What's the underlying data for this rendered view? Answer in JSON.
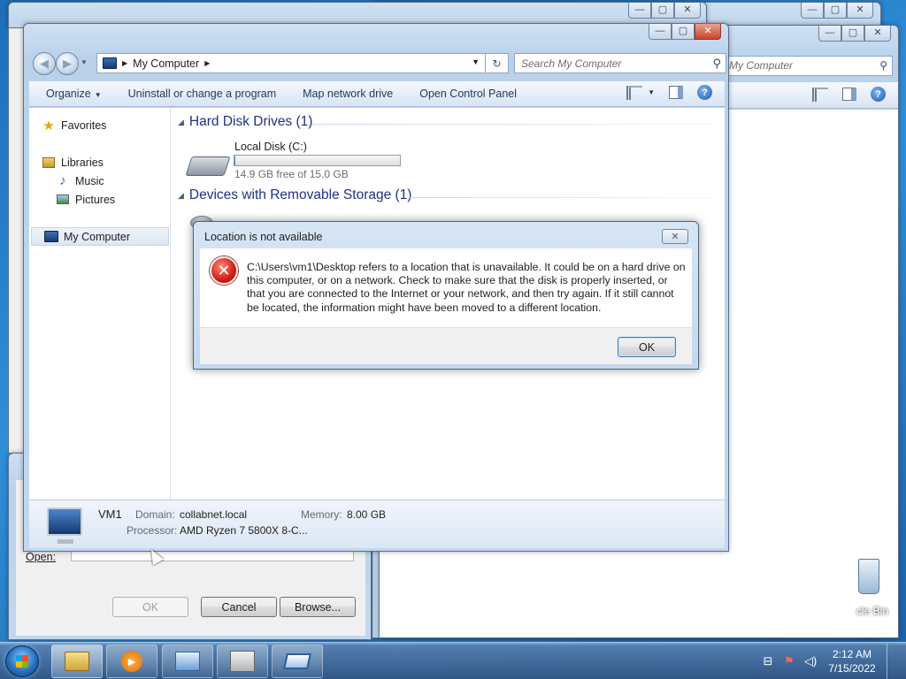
{
  "explorer": {
    "breadcrumb": "My Computer",
    "search_placeholder": "Search My Computer",
    "commands": [
      "Organize",
      "Uninstall or change a program",
      "Map network drive",
      "Open Control Panel"
    ],
    "nav": {
      "favorites": "Favorites",
      "libraries": "Libraries",
      "music": "Music",
      "pictures": "Pictures",
      "my_computer": "My Computer"
    },
    "groups": {
      "hard_disk": "Hard Disk Drives (1)",
      "removable": "Devices with Removable Storage (1)"
    },
    "drive": {
      "label": "Local Disk (C:)",
      "free": "14.9 GB free of 15.0 GB",
      "used_fraction": 0.007
    },
    "details": {
      "name": "VM1",
      "domain_key": "Domain:",
      "domain_val": "collabnet.local",
      "memory_key": "Memory:",
      "memory_val": "8.00 GB",
      "processor_key": "Processor:",
      "processor_val": "AMD Ryzen 7 5800X 8-C..."
    }
  },
  "background_window": {
    "search_placeholder": "My Computer"
  },
  "run_dialog": {
    "open_label": "Open:",
    "ok": "OK",
    "cancel": "Cancel",
    "browse": "Browse..."
  },
  "error_dialog": {
    "title": "Location is not available",
    "message": "C:\\Users\\vm1\\Desktop refers to a location that is unavailable. It could be on a hard drive on this computer, or on a network. Check to make sure that the disk is properly inserted, or that you are connected to the Internet or your network, and then try again. If it still cannot be located, the information might have been moved to a different location.",
    "ok": "OK"
  },
  "desktop": {
    "recycle_label": "cle Bin"
  },
  "taskbar": {
    "time": "2:12 AM",
    "date": "7/15/2022"
  },
  "icons": [
    "back-icon",
    "forward-icon",
    "computer-icon",
    "refresh-icon",
    "search-icon",
    "view-icon",
    "preview-pane-icon",
    "help-icon",
    "star-icon",
    "library-icon",
    "music-icon",
    "pictures-icon",
    "drive-icon",
    "error-icon",
    "close-icon",
    "start-icon",
    "recycle-bin-icon"
  ]
}
